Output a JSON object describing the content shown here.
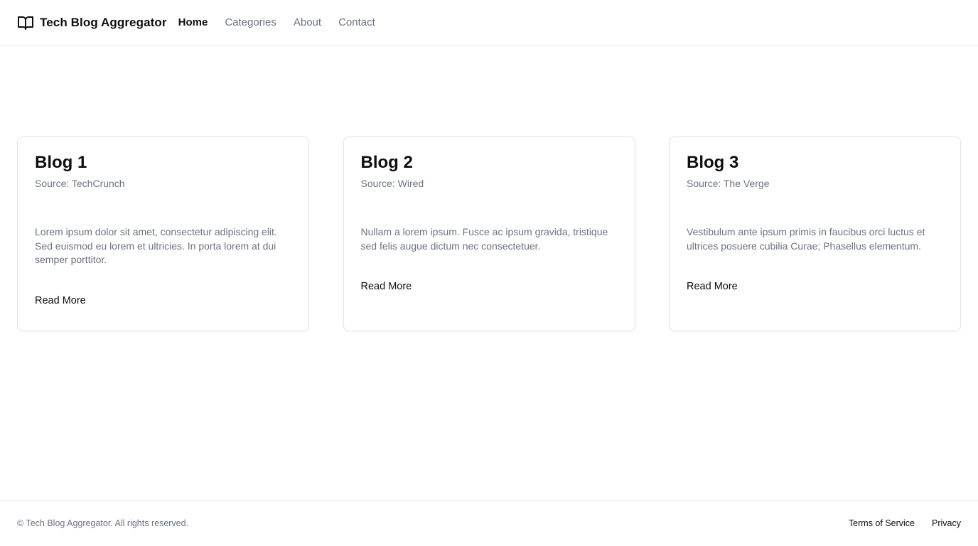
{
  "header": {
    "brand_title": "Tech Blog Aggregator",
    "brand_icon": "book-open-icon",
    "nav": [
      {
        "label": "Home",
        "active": true
      },
      {
        "label": "Categories",
        "active": false
      },
      {
        "label": "About",
        "active": false
      },
      {
        "label": "Contact",
        "active": false
      }
    ]
  },
  "cards": [
    {
      "title": "Blog 1",
      "source": "Source: TechCrunch",
      "excerpt": "Lorem ipsum dolor sit amet, consectetur adipiscing elit. Sed euismod eu lorem et ultricies. In porta lorem at dui semper porttitor.",
      "link_label": "Read More"
    },
    {
      "title": "Blog 2",
      "source": "Source: Wired",
      "excerpt": "Nullam a lorem ipsum. Fusce ac ipsum gravida, tristique sed felis augue dictum nec consectetuer.",
      "link_label": "Read More"
    },
    {
      "title": "Blog 3",
      "source": "Source: The Verge",
      "excerpt": "Vestibulum ante ipsum primis in faucibus orci luctus et ultrices posuere cubilia Curae; Phasellus elementum.",
      "link_label": "Read More"
    }
  ],
  "footer": {
    "copyright": "© Tech Blog Aggregator. All rights reserved.",
    "links": [
      "Terms of Service",
      "Privacy"
    ]
  },
  "colors": {
    "text_primary": "#0f0f0f",
    "text_muted": "#6b7280",
    "border": "#e6e7ea"
  }
}
